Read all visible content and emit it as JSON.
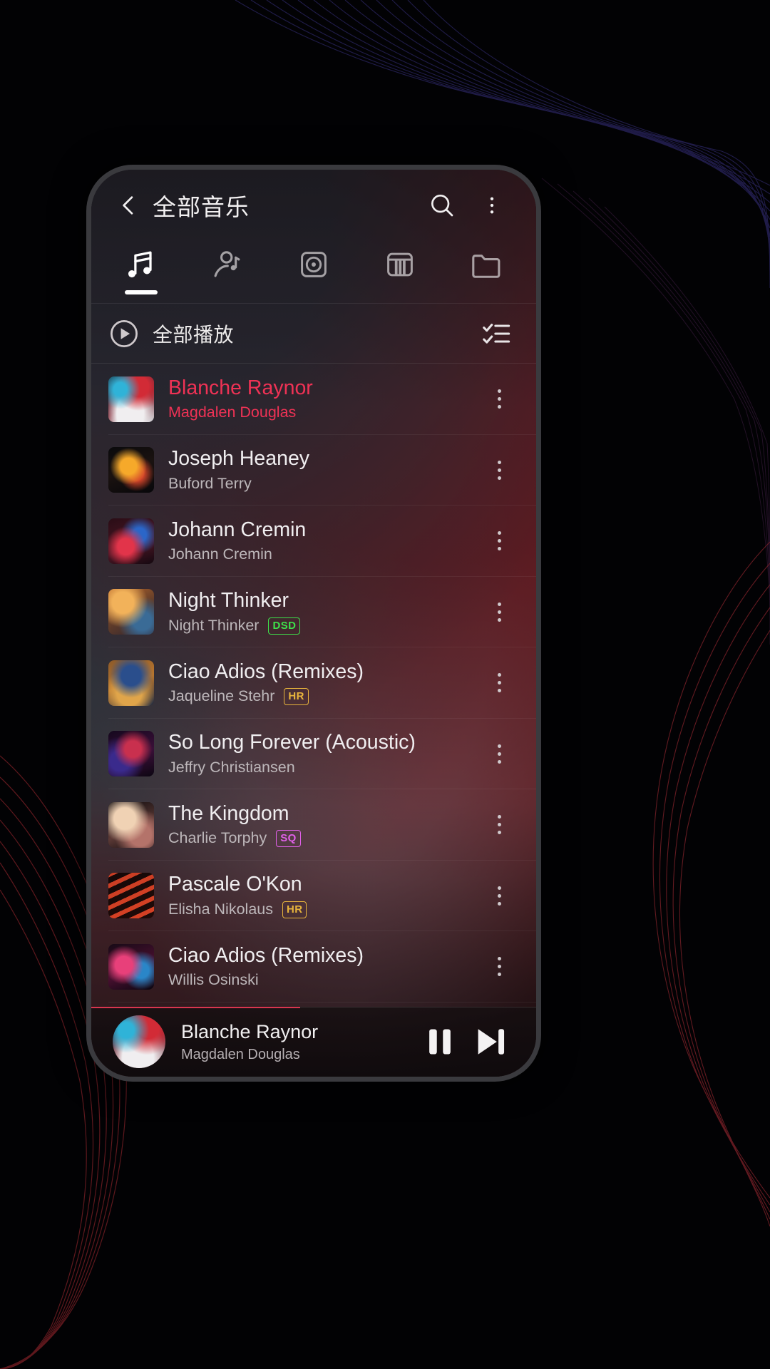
{
  "app": {
    "title": "全部音乐"
  },
  "topbar": {
    "back_icon": "chevron-left-icon",
    "search_icon": "search-icon",
    "overflow_icon": "more-vertical-icon"
  },
  "tabs": [
    {
      "id": "songs",
      "icon": "music-note-icon",
      "active": true
    },
    {
      "id": "artists",
      "icon": "artist-icon",
      "active": false
    },
    {
      "id": "albums",
      "icon": "album-disc-icon",
      "active": false
    },
    {
      "id": "genres",
      "icon": "piano-keys-icon",
      "active": false
    },
    {
      "id": "folders",
      "icon": "folder-icon",
      "active": false
    }
  ],
  "playall": {
    "label": "全部播放",
    "play_icon": "play-circle-icon",
    "multiselect_icon": "checklist-icon"
  },
  "tracks": [
    {
      "title": "Blanche Raynor",
      "artist": "Magdalen Douglas",
      "badge": "",
      "playing": true,
      "art": "ph1"
    },
    {
      "title": "Joseph Heaney",
      "artist": "Buford Terry",
      "badge": "",
      "playing": false,
      "art": "ph2"
    },
    {
      "title": "Johann Cremin",
      "artist": "Johann Cremin",
      "badge": "",
      "playing": false,
      "art": "ph3"
    },
    {
      "title": "Night Thinker",
      "artist": "Night Thinker",
      "badge": "DSD",
      "playing": false,
      "art": "ph4"
    },
    {
      "title": "Ciao Adios (Remixes)",
      "artist": "Jaqueline Stehr",
      "badge": "HR",
      "playing": false,
      "art": "ph5"
    },
    {
      "title": "So Long Forever (Acoustic)",
      "artist": "Jeffry Christiansen",
      "badge": "",
      "playing": false,
      "art": "ph6"
    },
    {
      "title": "The Kingdom",
      "artist": "Charlie Torphy",
      "badge": "SQ",
      "playing": false,
      "art": "ph7"
    },
    {
      "title": "Pascale O'Kon",
      "artist": "Elisha Nikolaus",
      "badge": "HR",
      "playing": false,
      "art": "ph8"
    },
    {
      "title": "Ciao Adios (Remixes)",
      "artist": "Willis Osinski",
      "badge": "",
      "playing": false,
      "art": "ph9"
    }
  ],
  "row_more_icon": "more-vertical-icon",
  "now_playing": {
    "title": "Blanche Raynor",
    "artist": "Magdalen Douglas",
    "pause_icon": "pause-icon",
    "next_icon": "skip-next-icon",
    "progress_percent": 47
  },
  "colors": {
    "accent": "#ef3255",
    "badge_dsd": "#3ee04a",
    "badge_hr": "#e8b43c",
    "badge_sq": "#e060e8",
    "text_primary": "#f0eef0",
    "text_secondary": "#bdb7ba"
  }
}
